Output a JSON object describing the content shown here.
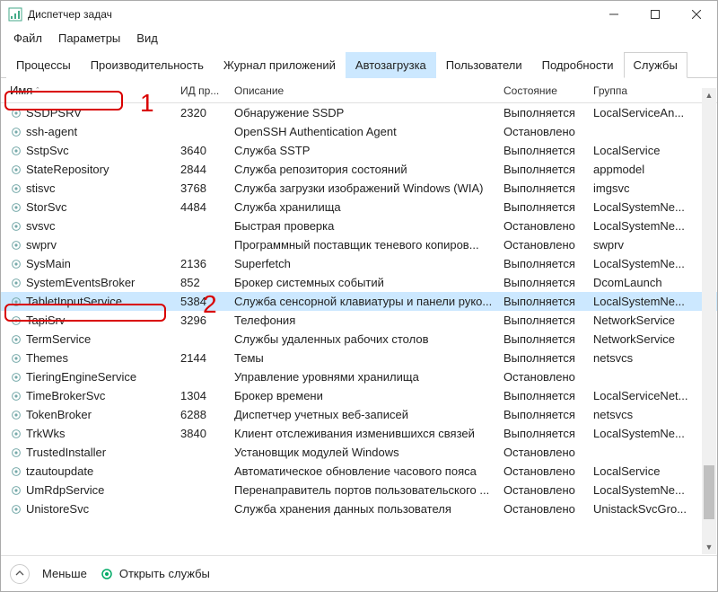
{
  "window": {
    "title": "Диспетчер задач"
  },
  "menu": {
    "file": "Файл",
    "options": "Параметры",
    "view": "Вид"
  },
  "tabs": {
    "processes": "Процессы",
    "performance": "Производительность",
    "apphistory": "Журнал приложений",
    "startup": "Автозагрузка",
    "users": "Пользователи",
    "details": "Подробности",
    "services": "Службы"
  },
  "columns": {
    "name": "Имя",
    "pid": "ИД пр...",
    "desc": "Описание",
    "state": "Состояние",
    "group": "Группа"
  },
  "rows": [
    {
      "name": "SSDPSRV",
      "pid": "2320",
      "desc": "Обнаружение SSDP",
      "state": "Выполняется",
      "group": "LocalServiceAn..."
    },
    {
      "name": "ssh-agent",
      "pid": "",
      "desc": "OpenSSH Authentication Agent",
      "state": "Остановлено",
      "group": ""
    },
    {
      "name": "SstpSvc",
      "pid": "3640",
      "desc": "Служба SSTP",
      "state": "Выполняется",
      "group": "LocalService"
    },
    {
      "name": "StateRepository",
      "pid": "2844",
      "desc": "Служба репозитория состояний",
      "state": "Выполняется",
      "group": "appmodel"
    },
    {
      "name": "stisvc",
      "pid": "3768",
      "desc": "Служба загрузки изображений Windows (WIA)",
      "state": "Выполняется",
      "group": "imgsvc"
    },
    {
      "name": "StorSvc",
      "pid": "4484",
      "desc": "Служба хранилища",
      "state": "Выполняется",
      "group": "LocalSystemNe..."
    },
    {
      "name": "svsvc",
      "pid": "",
      "desc": "Быстрая проверка",
      "state": "Остановлено",
      "group": "LocalSystemNe..."
    },
    {
      "name": "swprv",
      "pid": "",
      "desc": "Программный поставщик теневого копиров...",
      "state": "Остановлено",
      "group": "swprv"
    },
    {
      "name": "SysMain",
      "pid": "2136",
      "desc": "Superfetch",
      "state": "Выполняется",
      "group": "LocalSystemNe..."
    },
    {
      "name": "SystemEventsBroker",
      "pid": "852",
      "desc": "Брокер системных событий",
      "state": "Выполняется",
      "group": "DcomLaunch"
    },
    {
      "name": "TabletInputService",
      "pid": "5384",
      "desc": "Служба сенсорной клавиатуры и панели руко...",
      "state": "Выполняется",
      "group": "LocalSystemNe...",
      "selected": true
    },
    {
      "name": "TapiSrv",
      "pid": "3296",
      "desc": "Телефония",
      "state": "Выполняется",
      "group": "NetworkService"
    },
    {
      "name": "TermService",
      "pid": "",
      "desc": "Службы удаленных рабочих столов",
      "state": "Выполняется",
      "group": "NetworkService"
    },
    {
      "name": "Themes",
      "pid": "2144",
      "desc": "Темы",
      "state": "Выполняется",
      "group": "netsvcs"
    },
    {
      "name": "TieringEngineService",
      "pid": "",
      "desc": "Управление уровнями хранилища",
      "state": "Остановлено",
      "group": ""
    },
    {
      "name": "TimeBrokerSvc",
      "pid": "1304",
      "desc": "Брокер времени",
      "state": "Выполняется",
      "group": "LocalServiceNet..."
    },
    {
      "name": "TokenBroker",
      "pid": "6288",
      "desc": "Диспетчер учетных веб-записей",
      "state": "Выполняется",
      "group": "netsvcs"
    },
    {
      "name": "TrkWks",
      "pid": "3840",
      "desc": "Клиент отслеживания изменившихся связей",
      "state": "Выполняется",
      "group": "LocalSystemNe..."
    },
    {
      "name": "TrustedInstaller",
      "pid": "",
      "desc": "Установщик модулей Windows",
      "state": "Остановлено",
      "group": ""
    },
    {
      "name": "tzautoupdate",
      "pid": "",
      "desc": "Автоматическое обновление часового пояса",
      "state": "Остановлено",
      "group": "LocalService"
    },
    {
      "name": "UmRdpService",
      "pid": "",
      "desc": "Перенаправитель портов пользовательского ...",
      "state": "Остановлено",
      "group": "LocalSystemNe..."
    },
    {
      "name": "UnistoreSvc",
      "pid": "",
      "desc": "Служба хранения данных пользователя",
      "state": "Остановлено",
      "group": "UnistackSvcGro..."
    }
  ],
  "footer": {
    "less": "Меньше",
    "open_services": "Открыть службы"
  },
  "annotations": {
    "one": "1",
    "two": "2"
  }
}
